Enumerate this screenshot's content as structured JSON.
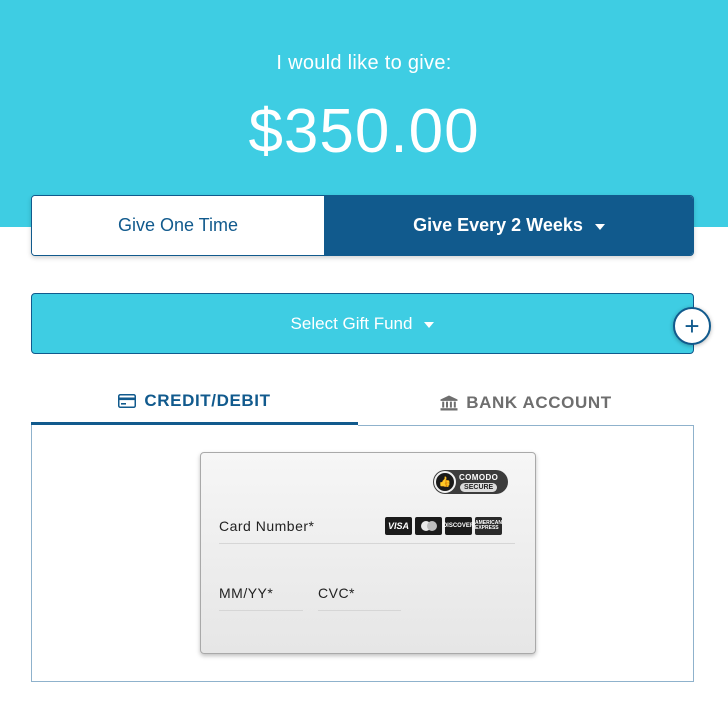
{
  "hero": {
    "label": "I would like to give:",
    "amount": "$350.00",
    "background_color": "#3ecde3"
  },
  "frequency": {
    "one_time_label": "Give One Time",
    "recurring_label": "Give Every 2 Weeks",
    "selected": "recurring",
    "active_color": "#115a8d"
  },
  "fund": {
    "label": "Select Gift Fund",
    "add_icon": "plus-icon"
  },
  "payment_tabs": {
    "credit_label": "CREDIT/DEBIT",
    "credit_icon": "credit-card-icon",
    "bank_label": "BANK ACCOUNT",
    "bank_icon": "bank-icon",
    "active": "credit"
  },
  "card_form": {
    "security_badge": {
      "brand": "COMODO",
      "tag": "SECURE"
    },
    "card_number_label": "Card Number*",
    "expiry_label": "MM/YY*",
    "cvc_label": "CVC*",
    "accepted_brands": {
      "visa": "VISA",
      "mastercard": "mastercard-icon",
      "discover": "DISCOVER",
      "amex": "AMERICAN EXPRESS"
    }
  }
}
